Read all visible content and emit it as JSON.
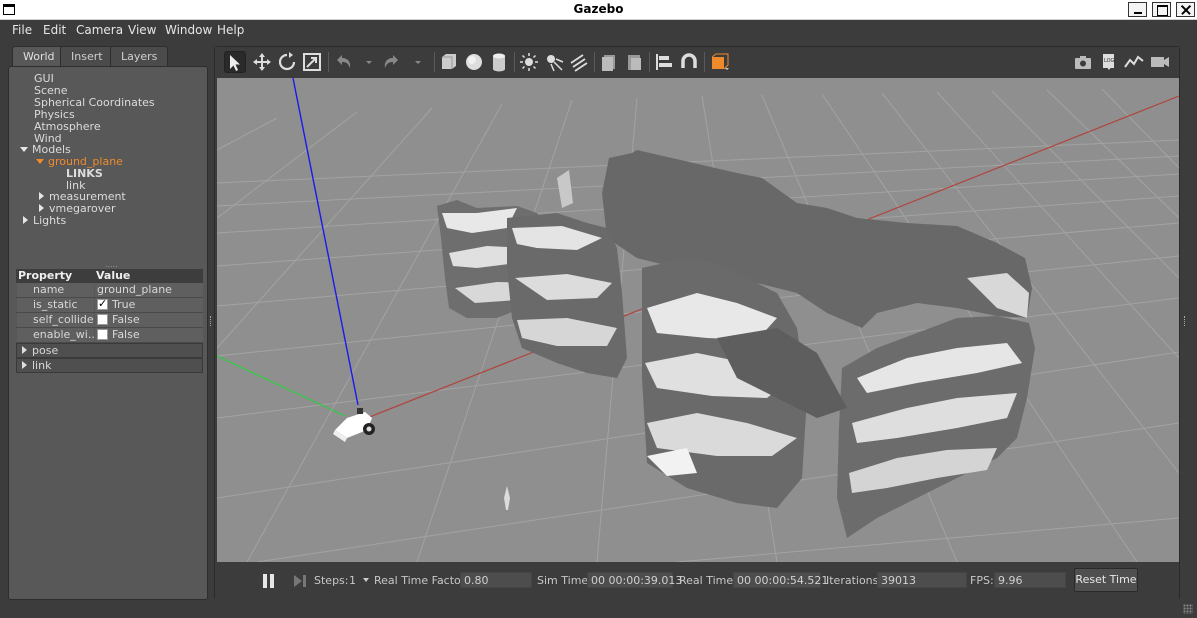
{
  "window": {
    "title": "Gazebo"
  },
  "menu": [
    "File",
    "Edit",
    "Camera",
    "View",
    "Window",
    "Help"
  ],
  "left_tabs": [
    "World",
    "Insert",
    "Layers"
  ],
  "tree": {
    "gui": "GUI",
    "scene": "Scene",
    "spherical": "Spherical Coordinates",
    "physics": "Physics",
    "atmosphere": "Atmosphere",
    "wind": "Wind",
    "models": "Models",
    "ground_plane": "ground_plane",
    "links": "LINKS",
    "link": "link",
    "measurement": "measurement",
    "vmegarover": "vmegarover",
    "lights": "Lights"
  },
  "properties": {
    "header_property": "Property",
    "header_value": "Value",
    "rows": [
      {
        "name": "name",
        "value": "ground_plane"
      },
      {
        "name": "is_static",
        "value": "True",
        "checked": true
      },
      {
        "name": "self_collide",
        "value": "False",
        "checked": false
      },
      {
        "name": "enable_wi...",
        "value": "False",
        "checked": false
      }
    ],
    "groups": [
      "pose",
      "link"
    ]
  },
  "toolbar": {
    "icons": [
      "select-arrow-icon",
      "translate-icon",
      "rotate-icon",
      "scale-icon",
      "undo-icon",
      "redo-icon",
      "box-icon",
      "sphere-icon",
      "cylinder-icon",
      "point-light-icon",
      "spot-light-icon",
      "directional-light-icon",
      "copy-icon",
      "paste-icon",
      "align-icon",
      "snap-icon",
      "view-angle-icon",
      "screenshot-icon",
      "log-icon",
      "plot-icon",
      "record-icon"
    ],
    "accent": "#ef8a2b"
  },
  "bottom": {
    "steps_label": "Steps:",
    "steps_value": "1",
    "rtf_label": "Real Time Factor:",
    "rtf_value": "0.80",
    "sim_label": "Sim Time:",
    "sim_value": "00 00:00:39.013",
    "real_label": "Real Time:",
    "real_value": "00 00:00:54.521",
    "iter_label": "Iterations:",
    "iter_value": "39013",
    "fps_label": "FPS:",
    "fps_value": "9.96",
    "reset_label": "Reset Time"
  },
  "colors": {
    "selected_text": "#ef8a2b",
    "viewport_bg": "#8f8f8f",
    "axis_x": "#c0392b",
    "axis_y": "#2ecc40",
    "axis_z": "#1a1aee"
  }
}
